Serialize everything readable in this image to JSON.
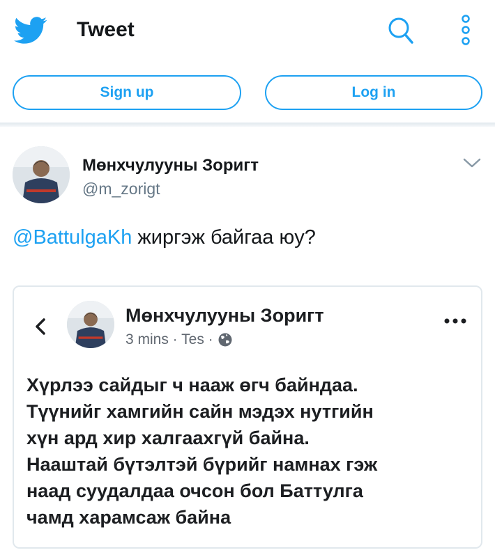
{
  "header": {
    "title": "Tweet",
    "icons": {
      "logo": "twitter-bird-icon",
      "search": "search-icon",
      "more": "more-vertical-icon"
    }
  },
  "auth": {
    "signup_label": "Sign up",
    "login_label": "Log in"
  },
  "tweet": {
    "author_name": "Мөнхчулууны Зоригт",
    "handle": "@m_zorigt",
    "mention": "@BattulgaKh",
    "text": " жиргэж байгаа юу?"
  },
  "embedded_post": {
    "author_name": "Мөнхчулууны Зоригт",
    "meta": "3 mins · Tes ·",
    "lines": [
      "Хүрлээ сайдыг ч нааж өгч байндаа.",
      "Түүнийг хамгийн сайн мэдэх нутгийн",
      "хүн ард хир халгаахгүй байна.",
      "Нааштай бүтэлтэй бүрийг намнах гэж",
      "наад суудалдаа очсон бол Баттулга",
      "чамд харамсаж байна"
    ]
  },
  "colors": {
    "accent": "#1da1f2",
    "text": "#14171a",
    "muted": "#657786",
    "border": "#e1e8ed"
  }
}
